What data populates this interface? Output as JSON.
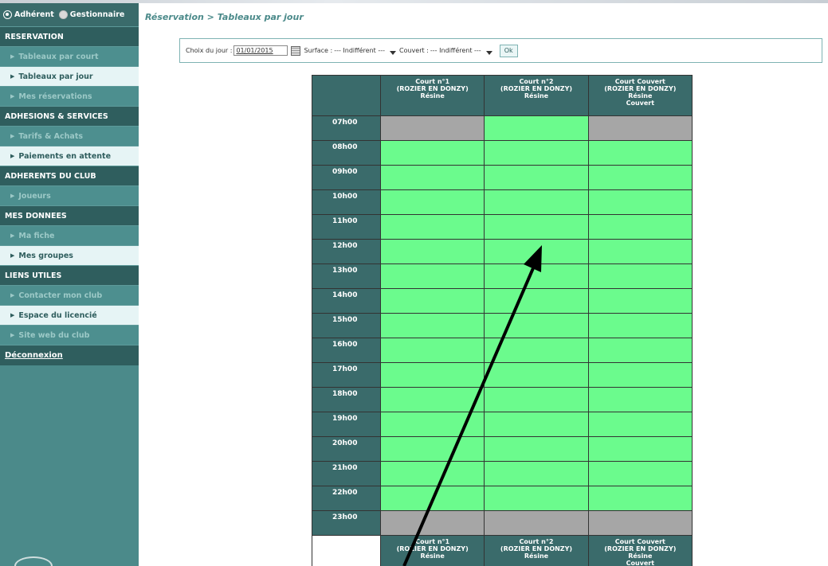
{
  "roles": {
    "adherent": "Adhérent",
    "gestionnaire": "Gestionnaire"
  },
  "menu": [
    {
      "type": "section",
      "label": "RESERVATION"
    },
    {
      "type": "item",
      "label": "Tableaux par court",
      "state": "dim"
    },
    {
      "type": "item",
      "label": "Tableaux par jour",
      "state": "lit"
    },
    {
      "type": "item",
      "label": "Mes réservations",
      "state": "dim"
    },
    {
      "type": "section",
      "label": "ADHESIONS & SERVICES"
    },
    {
      "type": "item",
      "label": "Tarifs & Achats",
      "state": "dim"
    },
    {
      "type": "item",
      "label": "Paiements en attente",
      "state": "lit"
    },
    {
      "type": "section",
      "label": "ADHERENTS DU CLUB"
    },
    {
      "type": "item",
      "label": "Joueurs",
      "state": "dim"
    },
    {
      "type": "section",
      "label": "MES DONNEES"
    },
    {
      "type": "item",
      "label": "Ma fiche",
      "state": "dim"
    },
    {
      "type": "item",
      "label": "Mes groupes",
      "state": "lit"
    },
    {
      "type": "section",
      "label": "LIENS UTILES"
    },
    {
      "type": "item",
      "label": "Contacter mon club",
      "state": "dim"
    },
    {
      "type": "item",
      "label": "Espace du licencié",
      "state": "lit"
    },
    {
      "type": "item",
      "label": "Site web du club",
      "state": "dim"
    }
  ],
  "logout": "Déconnexion",
  "breadcrumb": "Réservation > Tableaux par jour",
  "filter": {
    "day_label": "Choix du jour :",
    "day_value": "01/01/2015",
    "surface_label": "Surface :",
    "surface_value": "--- Indifférent ---",
    "couvert_label": "Couvert :",
    "couvert_value": "--- Indifférent ---",
    "ok_label": "Ok"
  },
  "courts": [
    {
      "lines": [
        "Court n°1",
        "(ROZIER EN DONZY)",
        "Résine"
      ]
    },
    {
      "lines": [
        "Court n°2",
        "(ROZIER EN DONZY)",
        "Résine"
      ]
    },
    {
      "lines": [
        "Court Couvert",
        "(ROZIER EN DONZY)",
        "Résine",
        "Couvert"
      ]
    }
  ],
  "slots": [
    {
      "hour": "07h00",
      "status": [
        "closed",
        "free",
        "closed"
      ]
    },
    {
      "hour": "08h00",
      "status": [
        "free",
        "free",
        "free"
      ]
    },
    {
      "hour": "09h00",
      "status": [
        "free",
        "free",
        "free"
      ]
    },
    {
      "hour": "10h00",
      "status": [
        "free",
        "free",
        "free"
      ]
    },
    {
      "hour": "11h00",
      "status": [
        "free",
        "free",
        "free"
      ]
    },
    {
      "hour": "12h00",
      "status": [
        "free",
        "free",
        "free"
      ]
    },
    {
      "hour": "13h00",
      "status": [
        "free",
        "free",
        "free"
      ]
    },
    {
      "hour": "14h00",
      "status": [
        "free",
        "free",
        "free"
      ]
    },
    {
      "hour": "15h00",
      "status": [
        "free",
        "free",
        "free"
      ]
    },
    {
      "hour": "16h00",
      "status": [
        "free",
        "free",
        "free"
      ]
    },
    {
      "hour": "17h00",
      "status": [
        "free",
        "free",
        "free"
      ]
    },
    {
      "hour": "18h00",
      "status": [
        "free",
        "free",
        "free"
      ]
    },
    {
      "hour": "19h00",
      "status": [
        "free",
        "free",
        "free"
      ]
    },
    {
      "hour": "20h00",
      "status": [
        "free",
        "free",
        "free"
      ]
    },
    {
      "hour": "21h00",
      "status": [
        "free",
        "free",
        "free"
      ]
    },
    {
      "hour": "22h00",
      "status": [
        "free",
        "free",
        "free"
      ]
    },
    {
      "hour": "23h00",
      "status": [
        "closed",
        "closed",
        "closed"
      ]
    }
  ],
  "colors": {
    "sidebar": "#4b8a8a",
    "header": "#3a6b6b",
    "free": "#6bfb8d",
    "closed": "#a6a6a6"
  }
}
